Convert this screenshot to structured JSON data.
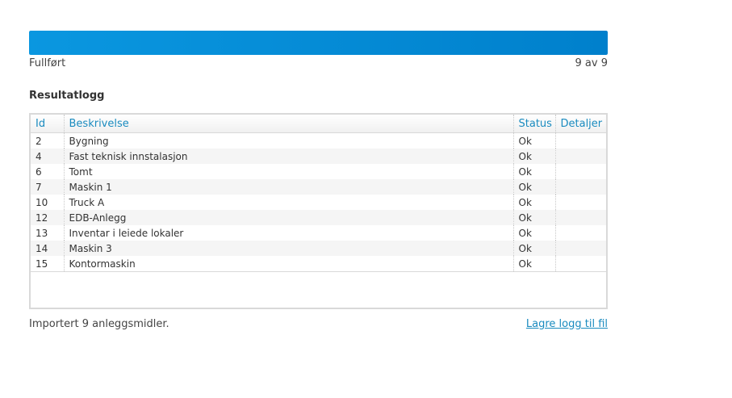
{
  "progress": {
    "label": "Fullført",
    "count_text": "9 av 9",
    "fraction": 1.0,
    "color": "#0a8dd8"
  },
  "log": {
    "title": "Resultatlogg",
    "columns": [
      "Id",
      "Beskrivelse",
      "Status",
      "Detaljer"
    ],
    "rows": [
      {
        "id": "2",
        "description": "Bygning",
        "status": "Ok",
        "details": ""
      },
      {
        "id": "4",
        "description": "Fast teknisk innstalasjon",
        "status": "Ok",
        "details": ""
      },
      {
        "id": "6",
        "description": "Tomt",
        "status": "Ok",
        "details": ""
      },
      {
        "id": "7",
        "description": "Maskin 1",
        "status": "Ok",
        "details": ""
      },
      {
        "id": "10",
        "description": "Truck A",
        "status": "Ok",
        "details": ""
      },
      {
        "id": "12",
        "description": "EDB-Anlegg",
        "status": "Ok",
        "details": ""
      },
      {
        "id": "13",
        "description": "Inventar i leiede lokaler",
        "status": "Ok",
        "details": ""
      },
      {
        "id": "14",
        "description": "Maskin 3",
        "status": "Ok",
        "details": ""
      },
      {
        "id": "15",
        "description": "Kontormaskin",
        "status": "Ok",
        "details": ""
      }
    ]
  },
  "footer": {
    "summary": "Importert 9 anleggsmidler.",
    "save_link": "Lagre logg til fil"
  }
}
